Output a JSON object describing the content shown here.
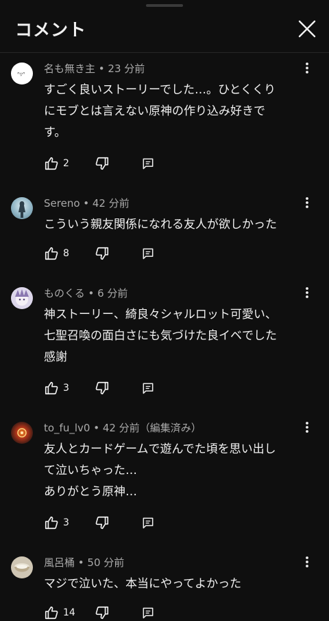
{
  "header": {
    "title": "コメント"
  },
  "comments": [
    {
      "author": "名も無き主",
      "time": "23 分前",
      "edited": "",
      "lines": [
        "すごく良いストーリーでした…。ひとくくり",
        "にモブとは言えない原神の作り込み好きで",
        "す。"
      ],
      "likes": "2"
    },
    {
      "author": "Sereno",
      "time": "42 分前",
      "edited": "",
      "lines": [
        "こういう親友関係になれる友人が欲しかった"
      ],
      "likes": "8"
    },
    {
      "author": "ものくる",
      "time": "6 分前",
      "edited": "",
      "lines": [
        "神ストーリー、綺良々シャルロット可愛い、",
        "七聖召喚の面白さにも気づけた良イベでした",
        "感謝"
      ],
      "likes": "3"
    },
    {
      "author": "to_fu_lv0",
      "time": "42 分前",
      "edited": "（編集済み）",
      "lines": [
        "友人とカードゲームで遊んでた頃を思い出し",
        "て泣いちゃった…",
        "ありがとう原神…"
      ],
      "likes": "3"
    },
    {
      "author": "風呂桶",
      "time": "50 分前",
      "edited": "",
      "lines": [
        "マジで泣いた、本当にやってよかった"
      ],
      "likes": "14"
    }
  ]
}
